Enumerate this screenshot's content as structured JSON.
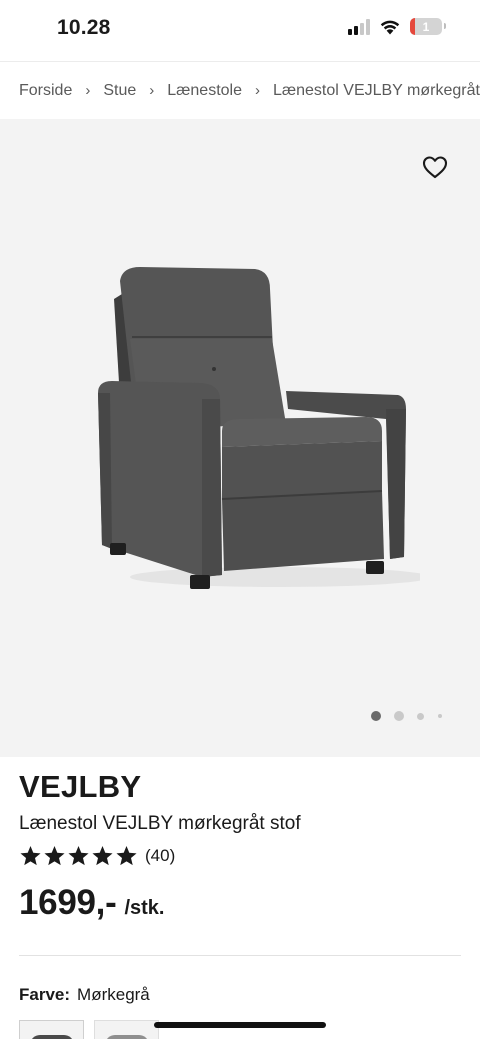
{
  "status_bar": {
    "time": "10.28",
    "battery_label": "1",
    "icons": [
      "cellular-signal-icon",
      "wifi-icon",
      "battery-icon"
    ]
  },
  "breadcrumb": {
    "items": [
      "Forside",
      "Stue",
      "Lænestole",
      "Lænestol VEJLBY mørkegråt"
    ],
    "separator": "›"
  },
  "gallery": {
    "image_count": 4,
    "active_index": 0,
    "wishlist_icon": "heart-outline-icon"
  },
  "product": {
    "brand": "VEJLBY",
    "subtitle": "Lænestol VEJLBY mørkegråt stof",
    "rating": 5,
    "rating_max": 5,
    "review_count": "(40)",
    "price": "1699,-",
    "price_unit": "/stk.",
    "color_label": "Farve:",
    "color_value": "Mørkegrå"
  },
  "colors": {
    "accent": "#1a1a1a",
    "background_gallery": "#f3f3f3",
    "chair_fabric": "#505050"
  }
}
